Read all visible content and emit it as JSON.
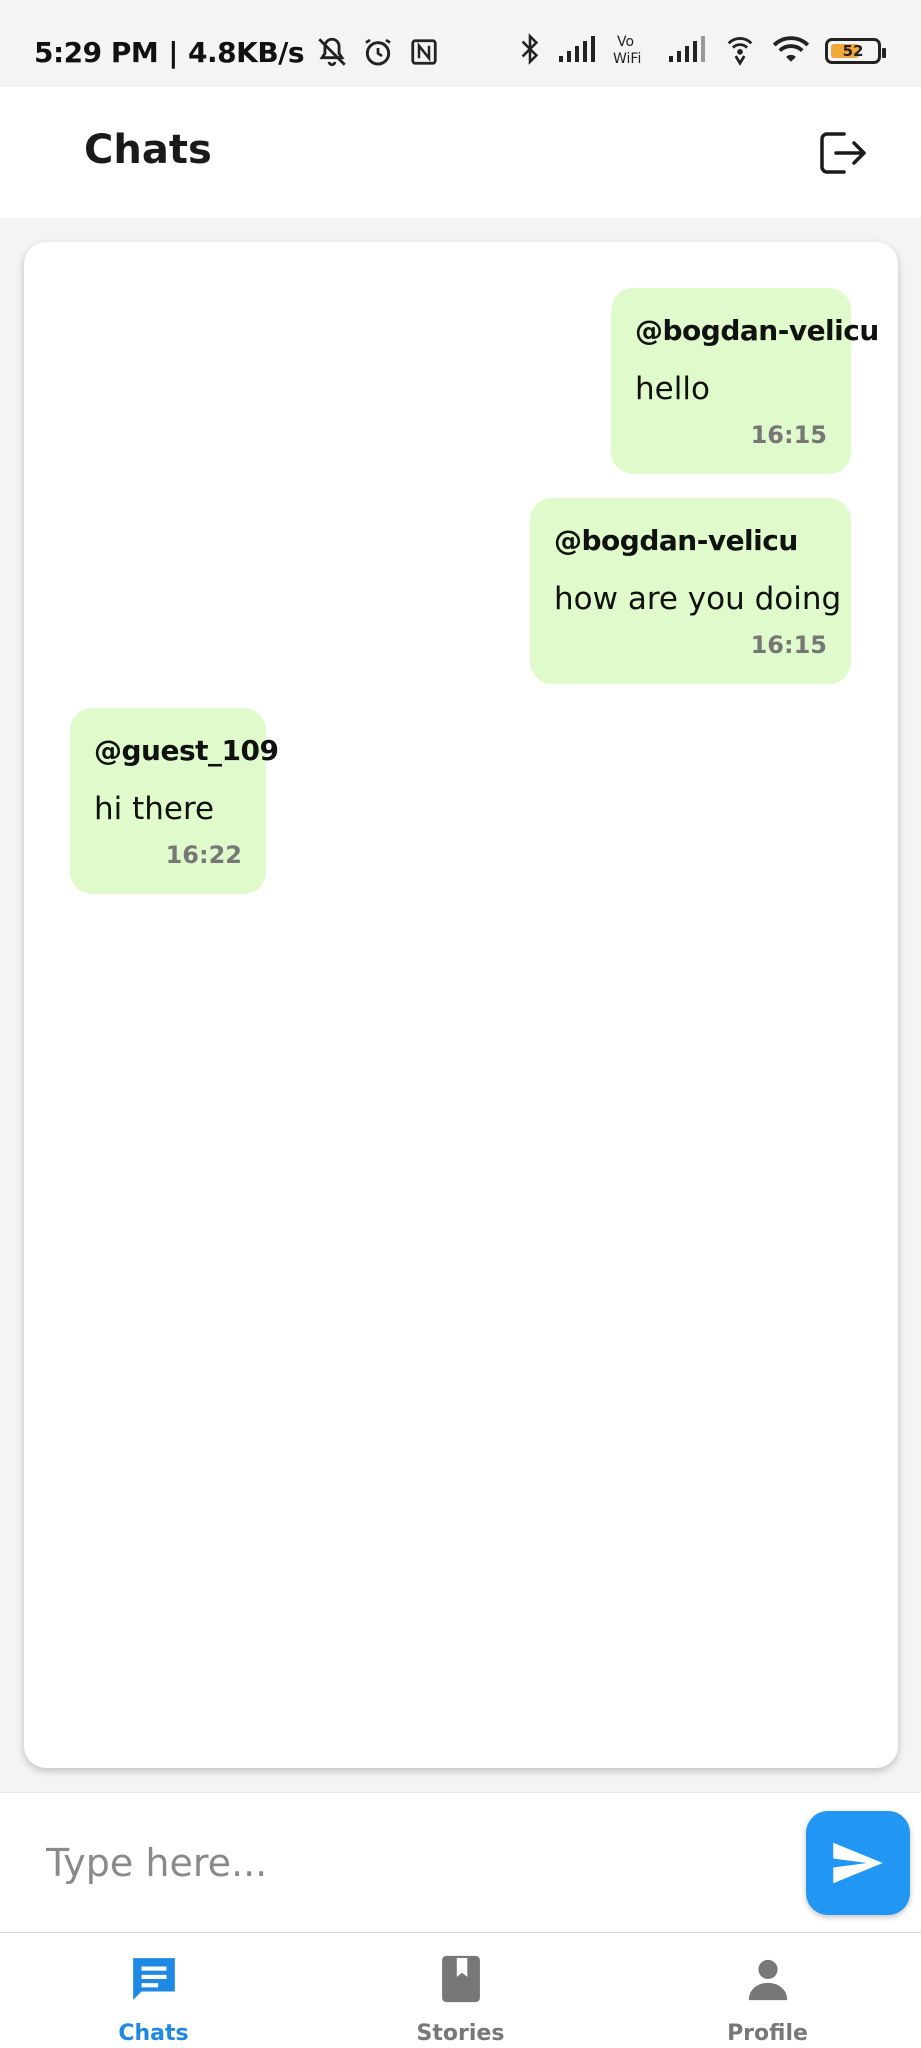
{
  "status_bar": {
    "time": "5:29 PM",
    "separator": "|",
    "speed": "4.8KB/s",
    "battery": "52",
    "icons": [
      "mute-icon",
      "alarm-icon",
      "nfc-icon",
      "bluetooth-icon",
      "signal-icon",
      "vowifi-icon",
      "signal-icon",
      "wifi-hotspot-icon",
      "wifi-icon",
      "battery-icon"
    ]
  },
  "header": {
    "title": "Chats",
    "logout_icon": "logout-icon"
  },
  "messages": [
    {
      "author": "@bogdan-velicu",
      "text": "hello",
      "time": "16:15",
      "side": "right"
    },
    {
      "author": "@bogdan-velicu",
      "text": "how are you doing",
      "time": "16:15",
      "side": "right"
    },
    {
      "author": "@guest_109",
      "text": "hi there",
      "time": "16:22",
      "side": "left"
    }
  ],
  "composer": {
    "placeholder": "Type here...",
    "value": "",
    "send_icon": "send-icon"
  },
  "nav": {
    "items": [
      {
        "label": "Chats",
        "icon": "chat-icon",
        "active": true
      },
      {
        "label": "Stories",
        "icon": "book-icon",
        "active": false
      },
      {
        "label": "Profile",
        "icon": "person-icon",
        "active": false
      }
    ]
  },
  "colors": {
    "accent": "#2196f3",
    "bubble": "#e0fbcb",
    "active_nav": "#1e88e5",
    "inactive_nav": "#777777"
  }
}
